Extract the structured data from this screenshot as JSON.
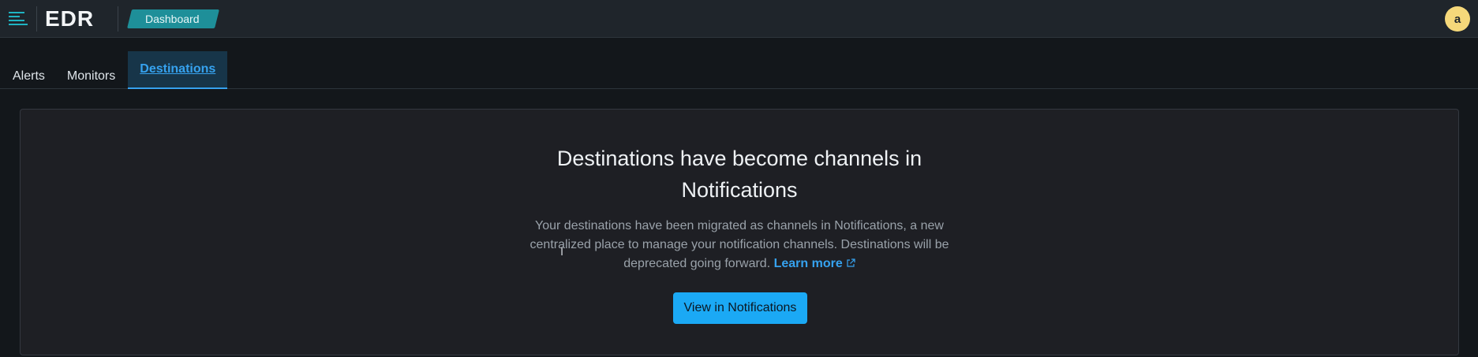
{
  "header": {
    "logo_text": "EDR",
    "breadcrumb": "Dashboard",
    "avatar_letter": "a",
    "menu_icon": "hamburger-menu-icon"
  },
  "tabs": [
    {
      "label": "Alerts",
      "active": false
    },
    {
      "label": "Monitors",
      "active": false
    },
    {
      "label": "Destinations",
      "active": true
    }
  ],
  "panel": {
    "title_line1": "Destinations have become channels in",
    "title_line2": "Notifications",
    "body_text": "Your destinations have been migrated as channels in Notifications, a new centralized place to manage your notification channels. Destinations will be deprecated going forward.",
    "learn_more": "Learn more",
    "external_icon": "external-link-icon",
    "button_label": "View in Notifications"
  },
  "colors": {
    "accent": "#36a2ef",
    "button": "#1ba9f5",
    "breadcrumb": "#1e8f99",
    "avatar": "#f5d87a"
  }
}
